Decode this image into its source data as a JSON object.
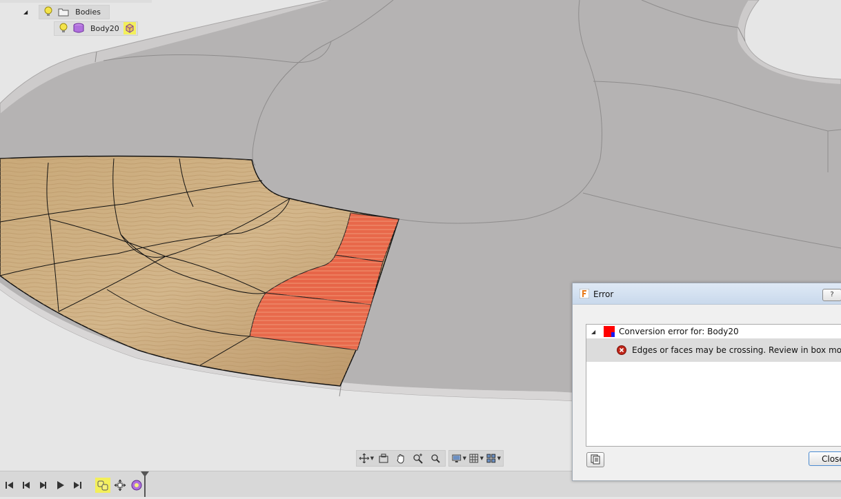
{
  "browser": {
    "bodies_folder": {
      "label": "Bodies",
      "icons": [
        "visibility-bulb-icon",
        "folder-icon"
      ]
    },
    "body_item": {
      "label": "Body20",
      "icons": [
        "visibility-bulb-icon",
        "tspline-body-icon",
        "box-mode-icon"
      ]
    }
  },
  "navigation_toolbar": {
    "groups": [
      [
        "orbit-icon",
        "look-at-icon",
        "pan-icon",
        "zoom-icon",
        "zoom-window-icon"
      ],
      [
        "display-settings-icon",
        "grid-settings-icon",
        "viewports-icon"
      ]
    ]
  },
  "timeline": {
    "controls": [
      "go-to-start-icon",
      "step-back-icon",
      "play-icon",
      "play-forward-icon",
      "go-to-end-icon"
    ],
    "features": [
      "form-feature-icon",
      "move-feature-icon",
      "repair-body-icon"
    ]
  },
  "dialog": {
    "title": "Error",
    "help_label": "?",
    "messages": [
      {
        "text": "Conversion error for: Body20",
        "icon": "error-flag-icon"
      },
      {
        "text": "Edges or faces may be crossing. Review in box mode.",
        "icon": "error-x-icon"
      }
    ],
    "close_label": "Close"
  },
  "colors": {
    "background": "#e6e6e6",
    "body_surface": "#b5b3b3",
    "wood": "#c7a67a",
    "error_highlight": "#e8684a",
    "selection_yellow": "#f3ef5a"
  }
}
